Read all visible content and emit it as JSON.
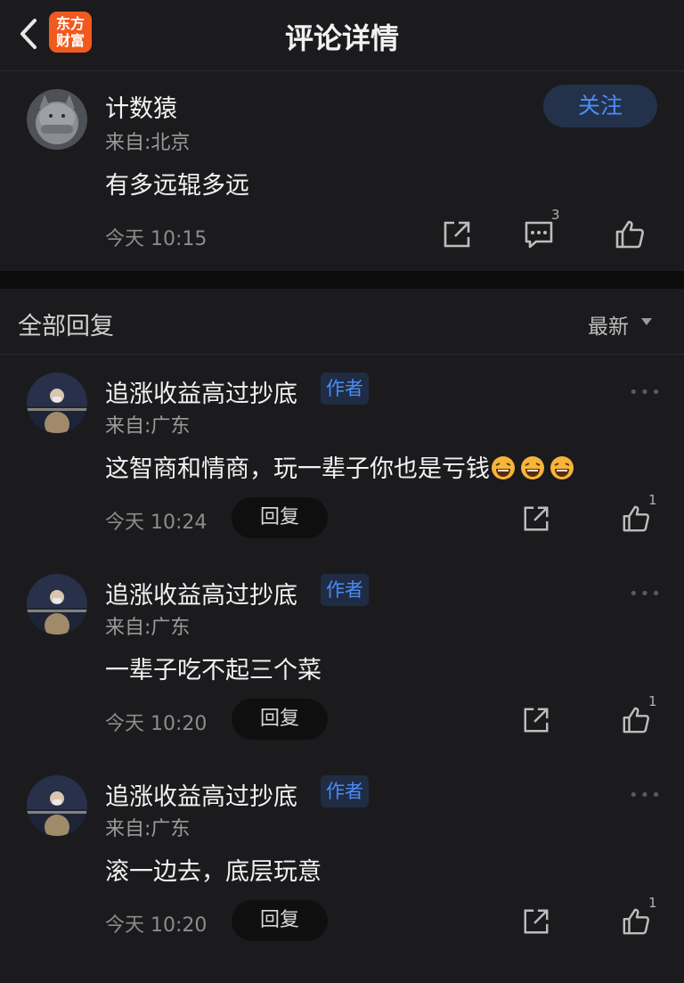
{
  "header": {
    "title": "评论详情",
    "logo_line1": "东方",
    "logo_line2": "财富",
    "back_icon": "chevron-left-icon"
  },
  "main_comment": {
    "user": "计数猿",
    "from": "来自:北京",
    "text": "有多远辊多远",
    "time": "今天 10:15",
    "follow_label": "关注",
    "comment_count": "3",
    "icons": [
      "share-icon",
      "comment-icon",
      "like-icon"
    ]
  },
  "section": {
    "title": "全部回复",
    "sort": "最新"
  },
  "replies": [
    {
      "user": "追涨收益高过抄底",
      "tag": "作者",
      "from": "来自:广东",
      "text": "这智商和情商，玩一辈子你也是亏钱",
      "emoji_count": 3,
      "time": "今天 10:24",
      "reply_label": "回复",
      "likes": "1"
    },
    {
      "user": "追涨收益高过抄底",
      "tag": "作者",
      "from": "来自:广东",
      "text": "一辈子吃不起三个菜",
      "time": "今天 10:20",
      "reply_label": "回复",
      "likes": "1"
    },
    {
      "user": "追涨收益高过抄底",
      "tag": "作者",
      "from": "来自:广东",
      "text": "滚一边去，底层玩意",
      "time": "今天 10:20",
      "reply_label": "回复",
      "likes": "1"
    }
  ],
  "colors": {
    "background": "#1b1b1d",
    "accent_blue": "#4b8cf5",
    "brand_orange": "#f05a1e"
  }
}
